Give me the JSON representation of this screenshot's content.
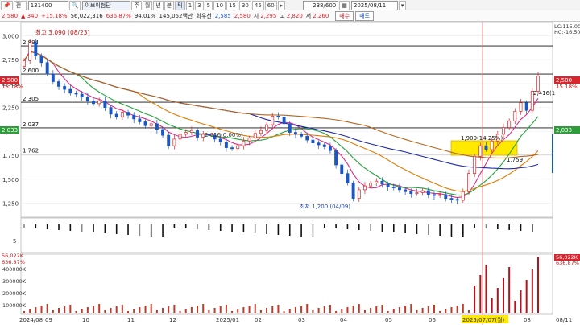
{
  "toolbar": {
    "pin_label": "📌",
    "market_select": "전",
    "code_input": "131400",
    "company_name": "이브이첨단",
    "period_buttons": [
      {
        "label": "주",
        "active": false
      },
      {
        "label": "월",
        "active": false
      },
      {
        "label": "년",
        "active": false
      },
      {
        "label": "분",
        "active": false
      },
      {
        "label": "틱",
        "active": true
      },
      {
        "label": "1",
        "active": false
      },
      {
        "label": "3",
        "active": false
      },
      {
        "label": "5",
        "active": false
      },
      {
        "label": "10",
        "active": false
      },
      {
        "label": "15",
        "active": false
      },
      {
        "label": "30",
        "active": false
      },
      {
        "label": "45",
        "active": false
      },
      {
        "label": "60",
        "active": false
      }
    ],
    "count": "238/600",
    "date": "2025/08/11"
  },
  "quote": {
    "price": "2,580",
    "change": "▲ 340",
    "change_pct": "+15.18%",
    "volume": "56,022,316",
    "volume_ratio": "636.87%",
    "strength": "94.01%",
    "amount": "145,052백만",
    "priority_label": "회우선",
    "ask": "2,585",
    "bid": "2,580",
    "open_label": "시",
    "open": "2,295",
    "high_label": "고",
    "high": "2,820",
    "low_label": "저",
    "low": "2,260",
    "buy_label": "매수",
    "sell_label": "매도"
  },
  "right_axis": {
    "lc": "LC:115.00",
    "hc": "HC:-16.50",
    "price_tag": "2,580",
    "pct_tag": "15.18%",
    "level_tag": "2,033",
    "vol_tag": "56,022K",
    "vol_pct_tag": "636.87%"
  },
  "left_tags": {
    "price": "2,580",
    "pct": "15.18%",
    "level": "2,033",
    "vol": "56,022K",
    "vol_pct": "636.87%"
  },
  "chart_data": {
    "type": "candlestick",
    "price_axis_ticks": [
      1250,
      1500,
      1750,
      2000,
      2250,
      2500,
      2750,
      3000
    ],
    "price_axis_labels": [
      "1,250",
      "1,500",
      "1,750",
      "2,000",
      "2,250",
      "2,500",
      "2,750",
      "3,000"
    ],
    "ylim": [
      1120,
      3130
    ],
    "horizontal_lines": [
      {
        "value": 2894,
        "label": "2,894"
      },
      {
        "value": 2600,
        "label": "2,600"
      },
      {
        "value": 2305,
        "label": "2,305"
      },
      {
        "value": 2037,
        "label": "2,037"
      },
      {
        "value": 1762,
        "label": "1,762"
      }
    ],
    "annotations": {
      "high": "최고 3,090 (08/23)",
      "low": "최저 1,200 (04/09)",
      "mid": "2,016(0.00%)",
      "box": "1,909(14.25%)",
      "recent": "2,416(1",
      "sub": "1,759"
    },
    "x_labels": [
      "2024/08",
      "09",
      "10",
      "11",
      "12",
      "2025/01",
      "02",
      "03",
      "04",
      "05",
      "06",
      "2025/07/07(월)",
      "08",
      "08/11"
    ],
    "indicator_axis_label": "5",
    "volume_axis_labels": [
      "400000K",
      "300000K",
      "200000K",
      "100000K"
    ],
    "series": [
      {
        "name": "close",
        "values": [
          2740,
          2930,
          2790,
          2720,
          2600,
          2520,
          2470,
          2440,
          2400,
          2390,
          2360,
          2320,
          2290,
          2320,
          2250,
          2180,
          2150,
          2200,
          2170,
          2130,
          2100,
          2060,
          2080,
          2020,
          1960,
          1850,
          1920,
          1970,
          1990,
          2010,
          1940,
          1970,
          1960,
          1920,
          1890,
          1830,
          1820,
          1850,
          1900,
          1930,
          1980,
          2010,
          2070,
          2160,
          2150,
          2080,
          1990,
          1970,
          1950,
          1910,
          1880,
          1860,
          1840,
          1800,
          1650,
          1560,
          1460,
          1300,
          1390,
          1430,
          1460,
          1480,
          1450,
          1420,
          1410,
          1390,
          1370,
          1350,
          1360,
          1380,
          1340,
          1330,
          1340,
          1300,
          1290,
          1280,
          1370,
          1560,
          1740,
          1850,
          1810,
          1900,
          1970,
          2040,
          2110,
          2210,
          2300,
          2220,
          2420,
          2580
        ]
      }
    ]
  }
}
